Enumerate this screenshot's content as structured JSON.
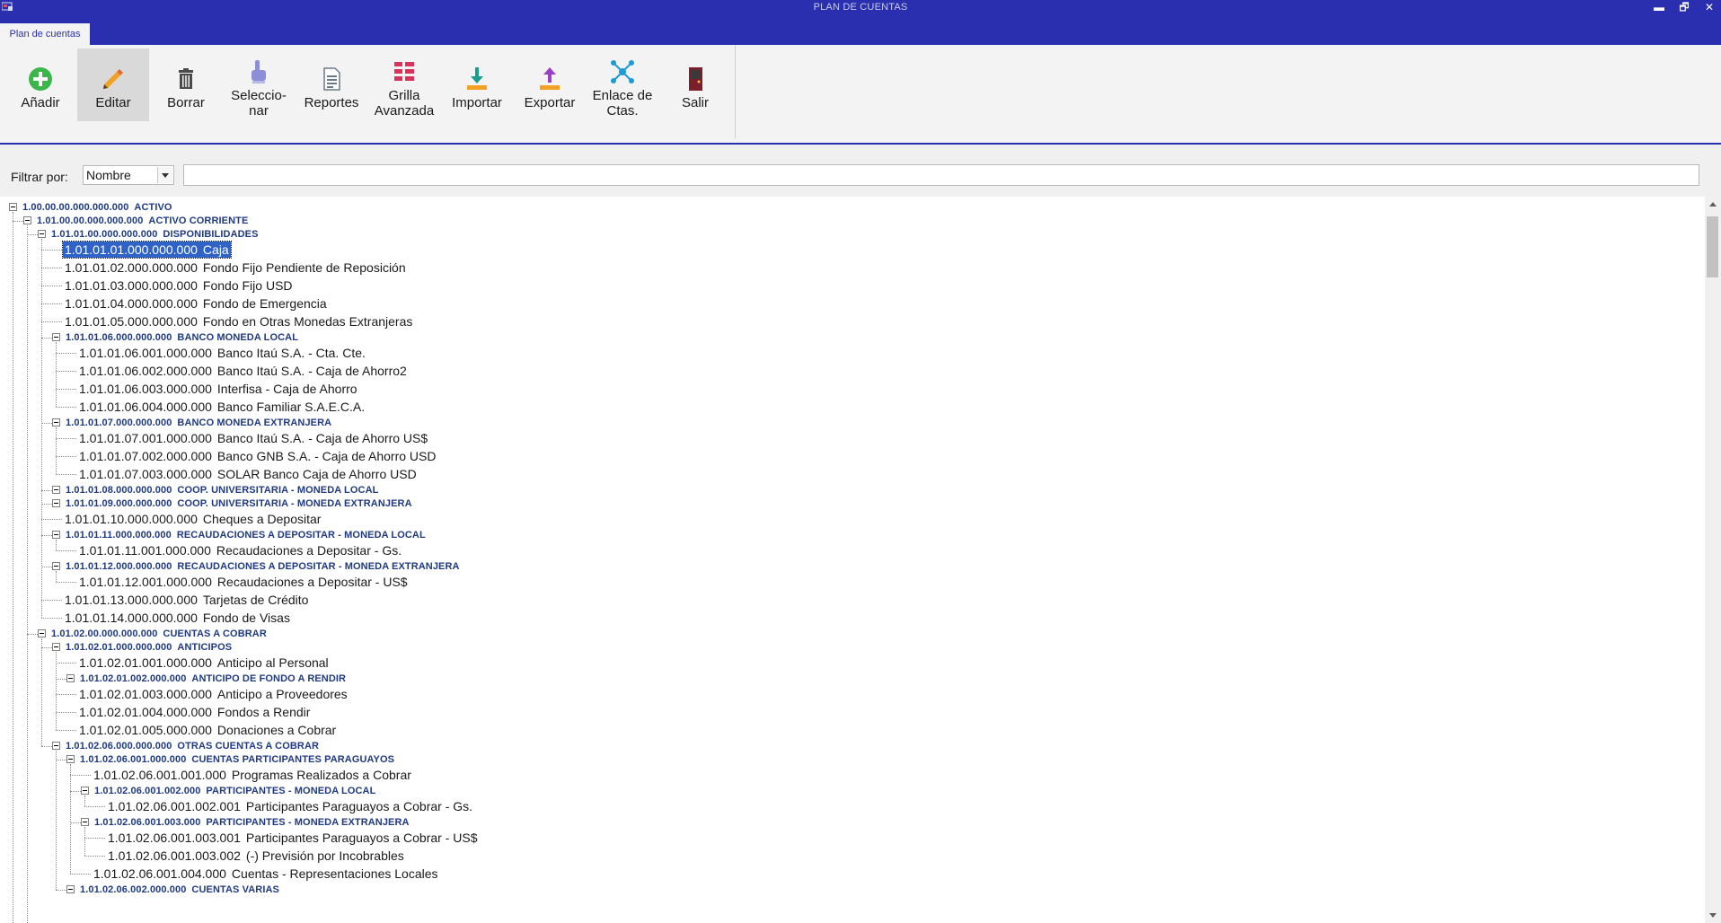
{
  "window": {
    "title": "PLAN DE CUENTAS",
    "controls": {
      "minimize": "▬",
      "restore": "🗗",
      "close": "✕"
    }
  },
  "tabs": [
    {
      "label": "Plan de cuentas",
      "active": true
    }
  ],
  "toolbar": {
    "buttons": [
      {
        "id": "add",
        "label_lines": [
          "Añadir"
        ],
        "icon": "add-circle-icon",
        "color": "#3cb54a"
      },
      {
        "id": "edit",
        "label_lines": [
          "Editar"
        ],
        "icon": "pencil-icon",
        "color": "#f2a125",
        "active": true
      },
      {
        "id": "delete",
        "label_lines": [
          "Borrar"
        ],
        "icon": "trash-icon",
        "color": "#4a4a4a"
      },
      {
        "id": "select",
        "label_lines": [
          "Seleccio-",
          "nar"
        ],
        "icon": "pointer-hand-icon",
        "color": "#8c8fd6"
      },
      {
        "id": "reports",
        "label_lines": [
          "Reportes"
        ],
        "icon": "document-icon",
        "color": "#6b7a8a"
      },
      {
        "id": "grid",
        "label_lines": [
          "Grilla",
          "Avanzada"
        ],
        "icon": "grid-icon",
        "color": "#d9335c"
      },
      {
        "id": "import",
        "label_lines": [
          "Importar"
        ],
        "icon": "import-icon",
        "color": "#f2a125"
      },
      {
        "id": "export",
        "label_lines": [
          "Exportar"
        ],
        "icon": "export-icon",
        "color": "#f2a125"
      },
      {
        "id": "link",
        "label_lines": [
          "Enlace de",
          "Ctas."
        ],
        "icon": "network-icon",
        "color": "#1e9bd7"
      },
      {
        "id": "exit",
        "label_lines": [
          "Salir"
        ],
        "icon": "door-exit-icon",
        "color": "#7a1f2b"
      }
    ]
  },
  "filter": {
    "label": "Filtrar por:",
    "selected": "Nombre",
    "text": ""
  },
  "tree": [
    {
      "depth": 0,
      "code": "1.00.00.00.000.000.000",
      "name": "ACTIVO",
      "group": true
    },
    {
      "depth": 1,
      "code": "1.01.00.00.000.000.000",
      "name": "ACTIVO CORRIENTE",
      "group": true
    },
    {
      "depth": 2,
      "code": "1.01.01.00.000.000.000",
      "name": "DISPONIBILIDADES",
      "group": true
    },
    {
      "depth": 3,
      "code": "1.01.01.01.000.000.000",
      "name": "Caja",
      "selected": true
    },
    {
      "depth": 3,
      "code": "1.01.01.02.000.000.000",
      "name": "Fondo Fijo Pendiente de Reposición"
    },
    {
      "depth": 3,
      "code": "1.01.01.03.000.000.000",
      "name": "Fondo Fijo USD"
    },
    {
      "depth": 3,
      "code": "1.01.01.04.000.000.000",
      "name": "Fondo de Emergencia"
    },
    {
      "depth": 3,
      "code": "1.01.01.05.000.000.000",
      "name": "Fondo en Otras Monedas Extranjeras"
    },
    {
      "depth": 3,
      "code": "1.01.01.06.000.000.000",
      "name": "BANCO MONEDA LOCAL",
      "group": true
    },
    {
      "depth": 4,
      "code": "1.01.01.06.001.000.000",
      "name": "Banco Itaú S.A. - Cta. Cte."
    },
    {
      "depth": 4,
      "code": "1.01.01.06.002.000.000",
      "name": "Banco Itaú S.A. - Caja de Ahorro2"
    },
    {
      "depth": 4,
      "code": "1.01.01.06.003.000.000",
      "name": "Interfisa - Caja de Ahorro"
    },
    {
      "depth": 4,
      "code": "1.01.01.06.004.000.000",
      "name": "Banco Familiar S.A.E.C.A."
    },
    {
      "depth": 3,
      "code": "1.01.01.07.000.000.000",
      "name": "BANCO MONEDA EXTRANJERA",
      "group": true
    },
    {
      "depth": 4,
      "code": "1.01.01.07.001.000.000",
      "name": "Banco Itaú S.A. - Caja de Ahorro US$"
    },
    {
      "depth": 4,
      "code": "1.01.01.07.002.000.000",
      "name": "Banco GNB S.A. - Caja de Ahorro USD"
    },
    {
      "depth": 4,
      "code": "1.01.01.07.003.000.000",
      "name": "SOLAR Banco Caja de Ahorro USD"
    },
    {
      "depth": 3,
      "code": "1.01.01.08.000.000.000",
      "name": "COOP. UNIVERSITARIA - MONEDA LOCAL",
      "group": true
    },
    {
      "depth": 3,
      "code": "1.01.01.09.000.000.000",
      "name": "COOP. UNIVERSITARIA - MONEDA EXTRANJERA",
      "group": true
    },
    {
      "depth": 3,
      "code": "1.01.01.10.000.000.000",
      "name": "Cheques a Depositar"
    },
    {
      "depth": 3,
      "code": "1.01.01.11.000.000.000",
      "name": "RECAUDACIONES A DEPOSITAR - MONEDA LOCAL",
      "group": true
    },
    {
      "depth": 4,
      "code": "1.01.01.11.001.000.000",
      "name": "Recaudaciones a Depositar - Gs."
    },
    {
      "depth": 3,
      "code": "1.01.01.12.000.000.000",
      "name": "RECAUDACIONES A DEPOSITAR - MONEDA EXTRANJERA",
      "group": true
    },
    {
      "depth": 4,
      "code": "1.01.01.12.001.000.000",
      "name": "Recaudaciones a Depositar - US$"
    },
    {
      "depth": 3,
      "code": "1.01.01.13.000.000.000",
      "name": "Tarjetas de Crédito"
    },
    {
      "depth": 3,
      "code": "1.01.01.14.000.000.000",
      "name": "Fondo de Visas"
    },
    {
      "depth": 2,
      "code": "1.01.02.00.000.000.000",
      "name": "CUENTAS A COBRAR",
      "group": true
    },
    {
      "depth": 3,
      "code": "1.01.02.01.000.000.000",
      "name": "ANTICIPOS",
      "group": true
    },
    {
      "depth": 4,
      "code": "1.01.02.01.001.000.000",
      "name": "Anticipo al Personal"
    },
    {
      "depth": 4,
      "code": "1.01.02.01.002.000.000",
      "name": "ANTICIPO DE FONDO A RENDIR",
      "group": true
    },
    {
      "depth": 4,
      "code": "1.01.02.01.003.000.000",
      "name": "Anticipo a Proveedores"
    },
    {
      "depth": 4,
      "code": "1.01.02.01.004.000.000",
      "name": "Fondos a Rendir"
    },
    {
      "depth": 4,
      "code": "1.01.02.01.005.000.000",
      "name": "Donaciones a Cobrar"
    },
    {
      "depth": 3,
      "code": "1.01.02.06.000.000.000",
      "name": "OTRAS CUENTAS A COBRAR",
      "group": true
    },
    {
      "depth": 4,
      "code": "1.01.02.06.001.000.000",
      "name": "CUENTAS PARTICIPANTES PARAGUAYOS",
      "group": true
    },
    {
      "depth": 5,
      "code": "1.01.02.06.001.001.000",
      "name": "Programas Realizados a Cobrar"
    },
    {
      "depth": 5,
      "code": "1.01.02.06.001.002.000",
      "name": "PARTICIPANTES - MONEDA LOCAL",
      "group": true
    },
    {
      "depth": 6,
      "code": "1.01.02.06.001.002.001",
      "name": "Participantes Paraguayos a Cobrar - Gs."
    },
    {
      "depth": 5,
      "code": "1.01.02.06.001.003.000",
      "name": "PARTICIPANTES - MONEDA EXTRANJERA",
      "group": true
    },
    {
      "depth": 6,
      "code": "1.01.02.06.001.003.001",
      "name": "Participantes Paraguayos a Cobrar - US$"
    },
    {
      "depth": 6,
      "code": "1.01.02.06.001.003.002",
      "name": "(-) Previsión por Incobrables"
    },
    {
      "depth": 5,
      "code": "1.01.02.06.001.004.000",
      "name": "Cuentas - Representaciones Locales"
    },
    {
      "depth": 4,
      "code": "1.01.02.06.002.000.000",
      "name": "CUENTAS VARIAS",
      "group": true
    }
  ]
}
